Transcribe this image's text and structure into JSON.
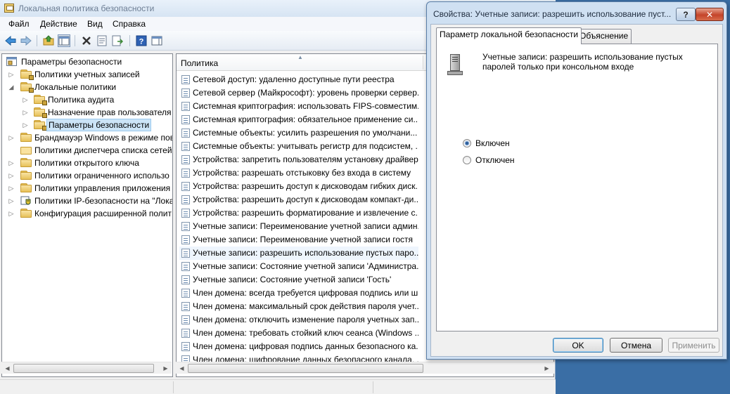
{
  "mmc": {
    "title": "Локальная политика безопасности",
    "menu": [
      "Файл",
      "Действие",
      "Вид",
      "Справка"
    ],
    "toolbar": [
      "back-arrow-icon",
      "forward-arrow-icon",
      "up-folder-icon",
      "show-hide-tree-icon",
      "delete-icon",
      "properties-icon",
      "export-list-icon",
      "help-icon",
      "console-icon"
    ]
  },
  "tree": {
    "items": [
      {
        "label": "Параметры безопасности",
        "level": 0,
        "expander": "",
        "icon": "root"
      },
      {
        "label": "Политики учетных записей",
        "level": 1,
        "expander": "▷",
        "icon": "folder"
      },
      {
        "label": "Локальные политики",
        "level": 1,
        "expander": "◢",
        "icon": "folder"
      },
      {
        "label": "Политика аудита",
        "level": 2,
        "expander": "▷",
        "icon": "folder"
      },
      {
        "label": "Назначение прав пользователя",
        "level": 2,
        "expander": "▷",
        "icon": "folder"
      },
      {
        "label": "Параметры безопасности",
        "level": 2,
        "expander": "▷",
        "icon": "folder",
        "selected": true
      },
      {
        "label": "Брандмауэр Windows в режиме пов",
        "level": 1,
        "expander": "▷",
        "icon": "folder"
      },
      {
        "label": "Политики диспетчера списка сетей",
        "level": 1,
        "expander": "",
        "icon": "folder-plain"
      },
      {
        "label": "Политики открытого ключа",
        "level": 1,
        "expander": "▷",
        "icon": "folder"
      },
      {
        "label": "Политики ограниченного использо",
        "level": 1,
        "expander": "▷",
        "icon": "folder"
      },
      {
        "label": "Политики управления приложения",
        "level": 1,
        "expander": "▷",
        "icon": "folder"
      },
      {
        "label": "Политики IP-безопасности на \"Лока",
        "level": 1,
        "expander": "▷",
        "icon": "shield"
      },
      {
        "label": "Конфигурация расширенной полит",
        "level": 1,
        "expander": "▷",
        "icon": "folder"
      }
    ]
  },
  "list": {
    "column": "Политика",
    "rows": [
      "Сетевой доступ: удаленно доступные пути реестра",
      "Сетевой сервер (Майкрософт): уровень проверки сервер...",
      "Системная криптография: использовать FIPS-совместим...",
      "Системная криптография: обязательное применение си...",
      "Системные объекты: усилить разрешения по умолчани...",
      "Системные объекты: учитывать регистр для подсистем, ...",
      "Устройства: запретить пользователям установку драйвер...",
      "Устройства: разрешать отстыковку без входа в систему",
      "Устройства: разрешить доступ к дисководам гибких диск...",
      "Устройства: разрешить доступ к дисководам компакт-ди...",
      "Устройства: разрешить форматирование и извлечение с...",
      "Учетные записи: Переименование учетной записи админ...",
      "Учетные записи: Переименование учетной записи гостя",
      "Учетные записи: разрешить использование пустых паро...",
      "Учетные записи: Состояние учетной записи 'Администра...",
      "Учетные записи: Состояние учетной записи 'Гость'",
      "Член домена: всегда требуется цифровая подпись или ш...",
      "Член домена: максимальный срок действия пароля учет...",
      "Член домена: отключить изменение пароля учетных зап...",
      "Член домена: требовать стойкий ключ сеанса (Windows ...",
      "Член домена: цифровая подпись данных безопасного ка...",
      "Член домена: шифрование данных безопасного канала, ..."
    ],
    "focused_index": 13
  },
  "dialog": {
    "title": "Свойства: Учетные записи: разрешить использование пуст...",
    "help_button": "?",
    "close_button": "✕",
    "tabs": [
      "Параметр локальной безопасности",
      "Объяснение"
    ],
    "active_tab": 0,
    "description": "Учетные записи: разрешить использование пустых паролей только при консольном входе",
    "options": [
      {
        "label": "Включен",
        "checked": true
      },
      {
        "label": "Отключен",
        "checked": false
      }
    ],
    "buttons": {
      "ok": "OK",
      "cancel": "Отмена",
      "apply": "Применить"
    }
  },
  "colors": {
    "selection": "#cce4f7",
    "dialog_frame": "#cfe0f2",
    "desktop": "#3a6ea5"
  }
}
